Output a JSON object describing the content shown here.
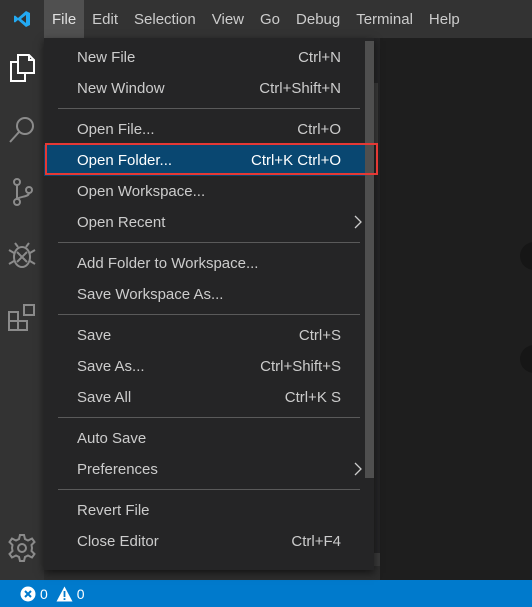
{
  "app": {
    "logo_icon": "vscode-logo-icon",
    "logo_color": "#23a9f2"
  },
  "menubar": {
    "items": [
      {
        "label": "File",
        "active": true
      },
      {
        "label": "Edit"
      },
      {
        "label": "Selection"
      },
      {
        "label": "View"
      },
      {
        "label": "Go"
      },
      {
        "label": "Debug"
      },
      {
        "label": "Terminal"
      },
      {
        "label": "Help"
      }
    ]
  },
  "activitybar": {
    "items": [
      {
        "name": "explorer",
        "icon": "files-icon"
      },
      {
        "name": "search",
        "icon": "search-icon"
      },
      {
        "name": "source-control",
        "icon": "source-control-icon"
      },
      {
        "name": "debug",
        "icon": "debug-icon"
      },
      {
        "name": "extensions",
        "icon": "extensions-icon"
      }
    ],
    "bottom": {
      "name": "manage",
      "icon": "gear-icon"
    }
  },
  "file_menu": {
    "groups": [
      [
        {
          "label": "New File",
          "shortcut": "Ctrl+N"
        },
        {
          "label": "New Window",
          "shortcut": "Ctrl+Shift+N"
        }
      ],
      [
        {
          "label": "Open File...",
          "shortcut": "Ctrl+O"
        },
        {
          "label": "Open Folder...",
          "shortcut": "Ctrl+K Ctrl+O",
          "selected": true
        },
        {
          "label": "Open Workspace...",
          "shortcut": ""
        },
        {
          "label": "Open Recent",
          "shortcut": "",
          "submenu": true
        }
      ],
      [
        {
          "label": "Add Folder to Workspace...",
          "shortcut": ""
        },
        {
          "label": "Save Workspace As...",
          "shortcut": ""
        }
      ],
      [
        {
          "label": "Save",
          "shortcut": "Ctrl+S"
        },
        {
          "label": "Save As...",
          "shortcut": "Ctrl+Shift+S"
        },
        {
          "label": "Save All",
          "shortcut": "Ctrl+K S"
        }
      ],
      [
        {
          "label": "Auto Save",
          "shortcut": ""
        },
        {
          "label": "Preferences",
          "shortcut": "",
          "submenu": true
        }
      ],
      [
        {
          "label": "Revert File",
          "shortcut": ""
        },
        {
          "label": "Close Editor",
          "shortcut": "Ctrl+F4"
        }
      ]
    ]
  },
  "statusbar": {
    "errors": "0",
    "warnings": "0",
    "error_icon": "error-icon",
    "warning_icon": "warning-icon"
  },
  "colors": {
    "accent": "#007acc",
    "selection": "#094771",
    "highlight_outline": "#e53935",
    "menu_bg": "#252526",
    "titlebar_bg": "#333333",
    "editor_bg": "#1e1e1e"
  }
}
